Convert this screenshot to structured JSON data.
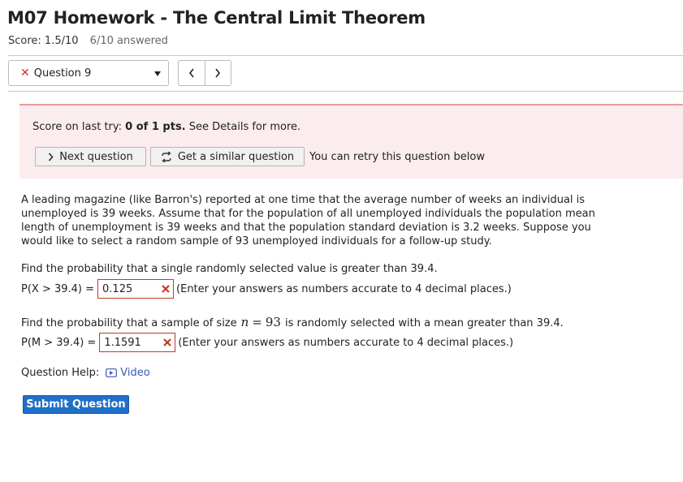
{
  "header": {
    "title": "M07 Homework - The Central Limit Theorem",
    "score": "Score: 1.5/10",
    "answered": "6/10 answered"
  },
  "nav": {
    "question_selected": "Question 9",
    "prev_icon": "chevron-left-icon",
    "next_icon": "chevron-right-icon"
  },
  "banner": {
    "prefix": "Score on last try:",
    "score": "0 of 1 pts.",
    "suffix": "See Details for more.",
    "next_question_label": "Next question",
    "similar_question_label": "Get a similar question",
    "retry_text": "You can retry this question below"
  },
  "problem": {
    "text": "A leading magazine (like Barron's) reported at one time that the average number of weeks an individual is unemployed is 39 weeks. Assume that for the population of all unemployed individuals the population mean length of unemployment is 39 weeks and that the population standard deviation is 3.2 weeks. Suppose you would like to select a random sample of 93 unemployed individuals for a follow-up study.",
    "part1": {
      "prompt": "Find the probability that a single randomly selected value is greater than 39.4.",
      "label": "P(X > 39.4) =",
      "value": "0.125",
      "hint": "(Enter your answers as numbers accurate to 4 decimal places.)"
    },
    "part2": {
      "prompt_before": "Find the probability that a sample of size",
      "n": "n",
      "eq": "=",
      "n_value": "93",
      "prompt_after": "is randomly selected with a mean greater than 39.4.",
      "label": "P(M > 39.4) =",
      "value": "1.1591",
      "hint": "(Enter your answers as numbers accurate to 4 decimal places.)"
    }
  },
  "help": {
    "label": "Question Help:",
    "video_label": "Video"
  },
  "submit_label": "Submit Question",
  "colors": {
    "accent": "#1f70c8",
    "error": "#c0392b",
    "banner_bg": "#fbeced",
    "banner_border": "#e89a9c",
    "link": "#3b5bb5"
  }
}
